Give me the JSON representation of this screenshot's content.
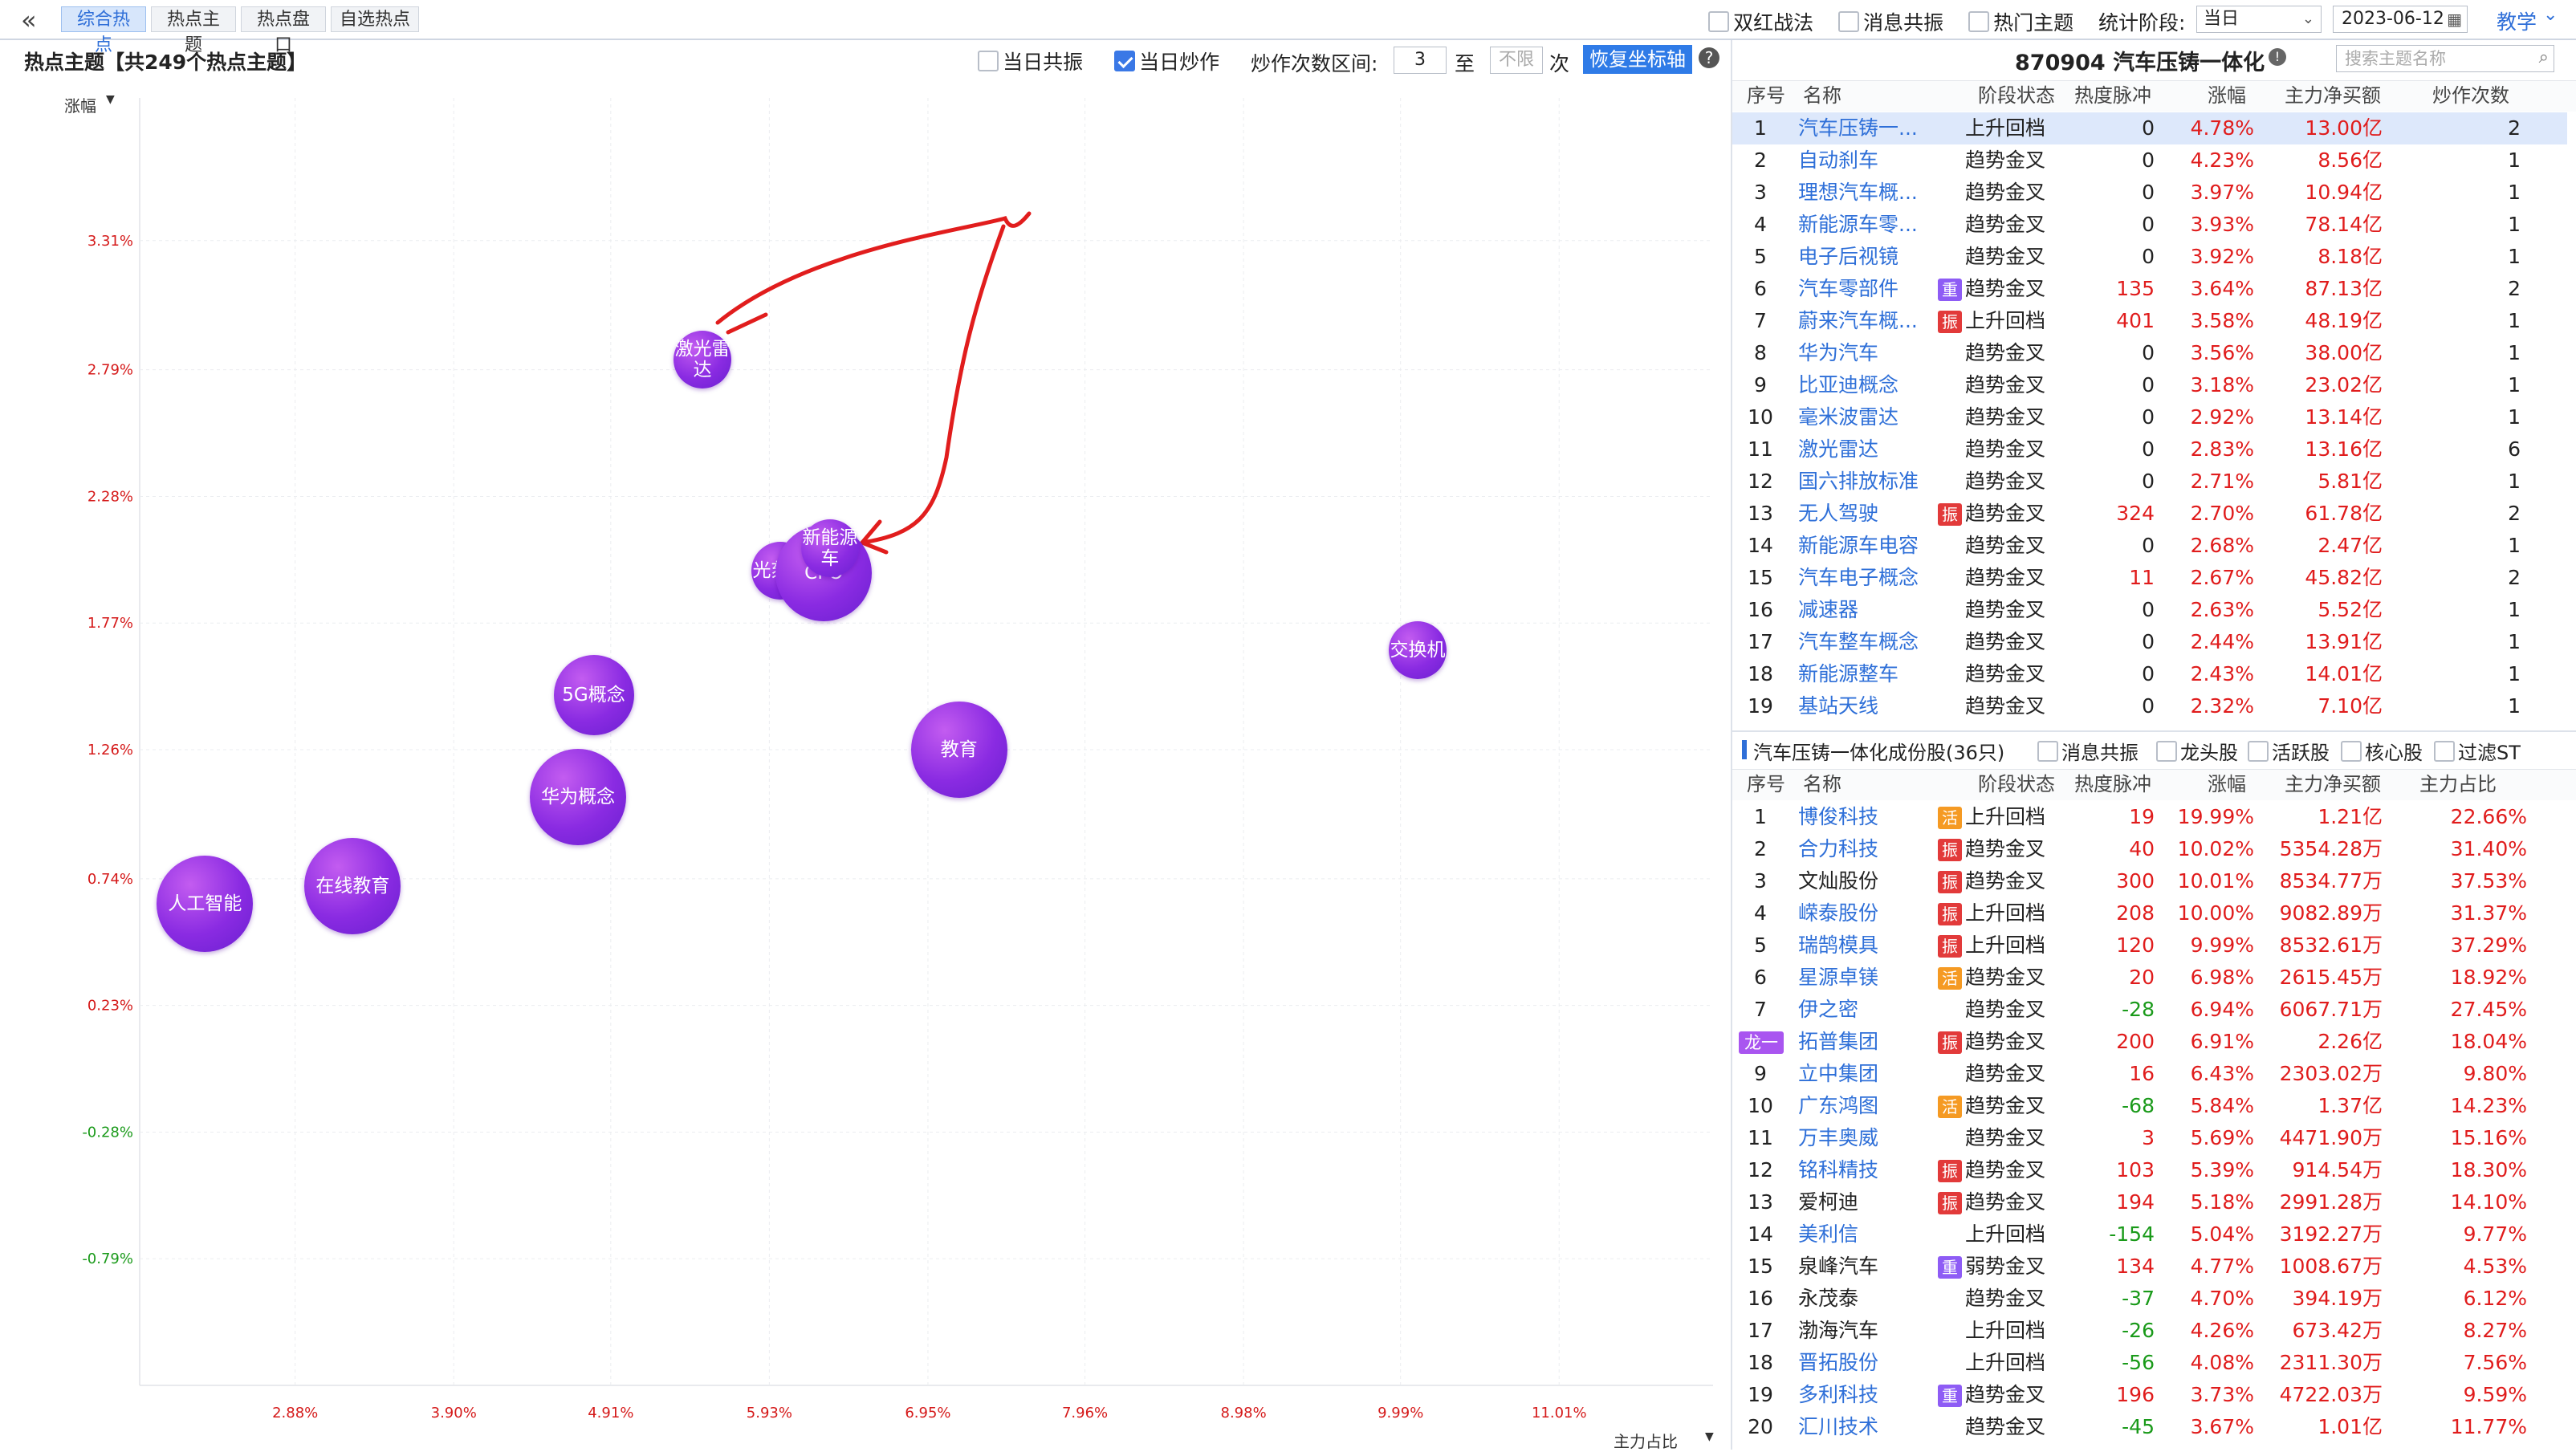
{
  "topbar": {
    "nav_icon": "double-chevron-left-icon",
    "tabs": [
      "综合热点",
      "热点主题",
      "热点盘口",
      "自选热点"
    ],
    "active_tab": 0,
    "options": [
      {
        "label": "双红战法",
        "checked": false
      },
      {
        "label": "消息共振",
        "checked": false
      },
      {
        "label": "热门主题",
        "checked": false
      }
    ],
    "period_label": "统计阶段:",
    "period_value": "当日",
    "date_value": "2023-06-12",
    "teach_label": "教学"
  },
  "chart_panel": {
    "title": "热点主题【共249个热点主题】",
    "same_day_resonance": {
      "label": "当日共振",
      "checked": false
    },
    "same_day_hype": {
      "label": "当日炒作",
      "checked": true
    },
    "range_label": "炒作次数区间:",
    "range_from": "3",
    "range_to_sep": "至",
    "range_to_placeholder": "不限",
    "range_unit": "次",
    "reset_button": "恢复坐标轴",
    "help_icon": "question-circle-icon",
    "y_axis_label": "涨幅",
    "x_axis_label": "主力占比"
  },
  "chart_data": {
    "type": "scatter",
    "xlabel": "主力占比",
    "ylabel": "涨幅",
    "y_ticks": [
      "3.31%",
      "2.79%",
      "2.28%",
      "1.77%",
      "1.26%",
      "0.74%",
      "0.23%",
      "-0.28%",
      "-0.79%"
    ],
    "y_tick_values": [
      3.31,
      2.79,
      2.28,
      1.77,
      1.26,
      0.74,
      0.23,
      -0.28,
      -0.79
    ],
    "x_ticks": [
      "2.88%",
      "3.90%",
      "4.91%",
      "5.93%",
      "6.95%",
      "7.96%",
      "8.98%",
      "9.99%",
      "11.01%"
    ],
    "x_tick_values": [
      2.88,
      3.9,
      4.91,
      5.93,
      6.95,
      7.96,
      8.98,
      9.99,
      11.01
    ],
    "xlim": [
      1.88,
      12.0
    ],
    "ylim": [
      -1.3,
      3.82
    ],
    "points": [
      {
        "name": "激光雷达",
        "x": 5.5,
        "y": 2.83,
        "size": 36,
        "lines": [
          "激光雷",
          "达"
        ]
      },
      {
        "name": "光刻机",
        "x": 6.0,
        "y": 1.98,
        "size": 36,
        "lines": [
          "光刻机"
        ]
      },
      {
        "name": "CPO",
        "x": 6.28,
        "y": 1.97,
        "size": 60,
        "lines": [
          "CPO"
        ]
      },
      {
        "name": "新能源车",
        "x": 6.32,
        "y": 2.07,
        "size": 36,
        "lines": [
          "新能源",
          "车"
        ]
      },
      {
        "name": "交换机",
        "x": 10.1,
        "y": 1.66,
        "size": 36,
        "lines": [
          "交换机"
        ]
      },
      {
        "name": "5G概念",
        "x": 4.8,
        "y": 1.48,
        "size": 50,
        "lines": [
          "5G概念"
        ]
      },
      {
        "name": "教育",
        "x": 7.15,
        "y": 1.26,
        "size": 60,
        "lines": [
          "教育"
        ]
      },
      {
        "name": "华为概念",
        "x": 4.7,
        "y": 1.07,
        "size": 60,
        "lines": [
          "华为概念"
        ]
      },
      {
        "name": "在线教育",
        "x": 3.25,
        "y": 0.71,
        "size": 60,
        "lines": [
          "在线教育"
        ]
      },
      {
        "name": "人工智能",
        "x": 2.3,
        "y": 0.64,
        "size": 60,
        "lines": [
          "人工智能"
        ]
      }
    ],
    "grid": true
  },
  "theme_panel": {
    "title": "870904 汽车压铸一体化",
    "info_icon": "info-circle-icon",
    "search_placeholder": "搜索主题名称",
    "search_icon": "search-icon",
    "headers": [
      "序号",
      "名称",
      "阶段状态",
      "热度脉冲",
      "涨幅",
      "主力净买额",
      "炒作次数"
    ],
    "rows": [
      {
        "no": "1",
        "name": "汽车压铸一...",
        "tag": "",
        "status": "上升回档",
        "pulse": "0",
        "chg": "4.78%",
        "net": "13.00亿",
        "count": "2"
      },
      {
        "no": "2",
        "name": "自动刹车",
        "tag": "",
        "status": "趋势金叉",
        "pulse": "0",
        "chg": "4.23%",
        "net": "8.56亿",
        "count": "1"
      },
      {
        "no": "3",
        "name": "理想汽车概...",
        "tag": "",
        "status": "趋势金叉",
        "pulse": "0",
        "chg": "3.97%",
        "net": "10.94亿",
        "count": "1"
      },
      {
        "no": "4",
        "name": "新能源车零...",
        "tag": "",
        "status": "趋势金叉",
        "pulse": "0",
        "chg": "3.93%",
        "net": "78.14亿",
        "count": "1"
      },
      {
        "no": "5",
        "name": "电子后视镜",
        "tag": "",
        "status": "趋势金叉",
        "pulse": "0",
        "chg": "3.92%",
        "net": "8.18亿",
        "count": "1"
      },
      {
        "no": "6",
        "name": "汽车零部件",
        "tag": "重",
        "status": "趋势金叉",
        "pulse": "135",
        "chg": "3.64%",
        "net": "87.13亿",
        "count": "2"
      },
      {
        "no": "7",
        "name": "蔚来汽车概...",
        "tag": "振",
        "status": "上升回档",
        "pulse": "401",
        "chg": "3.58%",
        "net": "48.19亿",
        "count": "1"
      },
      {
        "no": "8",
        "name": "华为汽车",
        "tag": "",
        "status": "趋势金叉",
        "pulse": "0",
        "chg": "3.56%",
        "net": "38.00亿",
        "count": "1"
      },
      {
        "no": "9",
        "name": "比亚迪概念",
        "tag": "",
        "status": "趋势金叉",
        "pulse": "0",
        "chg": "3.18%",
        "net": "23.02亿",
        "count": "1"
      },
      {
        "no": "10",
        "name": "毫米波雷达",
        "tag": "",
        "status": "趋势金叉",
        "pulse": "0",
        "chg": "2.92%",
        "net": "13.14亿",
        "count": "1"
      },
      {
        "no": "11",
        "name": "激光雷达",
        "tag": "",
        "status": "趋势金叉",
        "pulse": "0",
        "chg": "2.83%",
        "net": "13.16亿",
        "count": "6"
      },
      {
        "no": "12",
        "name": "国六排放标准",
        "tag": "",
        "status": "趋势金叉",
        "pulse": "0",
        "chg": "2.71%",
        "net": "5.81亿",
        "count": "1"
      },
      {
        "no": "13",
        "name": "无人驾驶",
        "tag": "振",
        "status": "趋势金叉",
        "pulse": "324",
        "chg": "2.70%",
        "net": "61.78亿",
        "count": "2"
      },
      {
        "no": "14",
        "name": "新能源车电容",
        "tag": "",
        "status": "趋势金叉",
        "pulse": "0",
        "chg": "2.68%",
        "net": "2.47亿",
        "count": "1"
      },
      {
        "no": "15",
        "name": "汽车电子概念",
        "tag": "",
        "status": "趋势金叉",
        "pulse": "11",
        "chg": "2.67%",
        "net": "45.82亿",
        "count": "2"
      },
      {
        "no": "16",
        "name": "减速器",
        "tag": "",
        "status": "趋势金叉",
        "pulse": "0",
        "chg": "2.63%",
        "net": "5.52亿",
        "count": "1"
      },
      {
        "no": "17",
        "name": "汽车整车概念",
        "tag": "",
        "status": "趋势金叉",
        "pulse": "0",
        "chg": "2.44%",
        "net": "13.91亿",
        "count": "1"
      },
      {
        "no": "18",
        "name": "新能源整车",
        "tag": "",
        "status": "趋势金叉",
        "pulse": "0",
        "chg": "2.43%",
        "net": "14.01亿",
        "count": "1"
      },
      {
        "no": "19",
        "name": "基站天线",
        "tag": "",
        "status": "趋势金叉",
        "pulse": "0",
        "chg": "2.32%",
        "net": "7.10亿",
        "count": "1"
      }
    ]
  },
  "stock_panel": {
    "title": "汽车压铸一体化成份股(36只)",
    "filters": [
      {
        "label": "消息共振",
        "checked": false
      },
      {
        "label": "龙头股",
        "checked": false
      },
      {
        "label": "活跃股",
        "checked": false
      },
      {
        "label": "核心股",
        "checked": false
      },
      {
        "label": "过滤ST",
        "checked": false
      }
    ],
    "headers": [
      "序号",
      "名称",
      "阶段状态",
      "热度脉冲",
      "涨幅",
      "主力净买额",
      "主力占比"
    ],
    "rows": [
      {
        "no": "1",
        "name": "博俊科技",
        "blue": true,
        "tag": "活",
        "status": "上升回档",
        "pulse": "19",
        "chg": "19.99%",
        "net": "1.21亿",
        "ratio": "22.66%"
      },
      {
        "no": "2",
        "name": "合力科技",
        "blue": true,
        "tag": "振",
        "status": "趋势金叉",
        "pulse": "40",
        "chg": "10.02%",
        "net": "5354.28万",
        "ratio": "31.40%"
      },
      {
        "no": "3",
        "name": "文灿股份",
        "blue": false,
        "tag": "振",
        "status": "趋势金叉",
        "pulse": "300",
        "chg": "10.01%",
        "net": "8534.77万",
        "ratio": "37.53%"
      },
      {
        "no": "4",
        "name": "嵘泰股份",
        "blue": true,
        "tag": "振",
        "status": "上升回档",
        "pulse": "208",
        "chg": "10.00%",
        "net": "9082.89万",
        "ratio": "31.37%"
      },
      {
        "no": "5",
        "name": "瑞鹄模具",
        "blue": true,
        "tag": "振",
        "status": "上升回档",
        "pulse": "120",
        "chg": "9.99%",
        "net": "8532.61万",
        "ratio": "37.29%"
      },
      {
        "no": "6",
        "name": "星源卓镁",
        "blue": true,
        "tag": "活",
        "status": "趋势金叉",
        "pulse": "20",
        "chg": "6.98%",
        "net": "2615.45万",
        "ratio": "18.92%"
      },
      {
        "no": "7",
        "name": "伊之密",
        "blue": true,
        "tag": "",
        "status": "趋势金叉",
        "pulse": "-28",
        "chg": "6.94%",
        "net": "6067.71万",
        "ratio": "27.45%"
      },
      {
        "no": "龙一",
        "name": "拓普集团",
        "blue": true,
        "tag": "振",
        "status": "趋势金叉",
        "pulse": "200",
        "chg": "6.91%",
        "net": "2.26亿",
        "ratio": "18.04%"
      },
      {
        "no": "9",
        "name": "立中集团",
        "blue": true,
        "tag": "",
        "status": "趋势金叉",
        "pulse": "16",
        "chg": "6.43%",
        "net": "2303.02万",
        "ratio": "9.80%"
      },
      {
        "no": "10",
        "name": "广东鸿图",
        "blue": true,
        "tag": "活",
        "status": "趋势金叉",
        "pulse": "-68",
        "chg": "5.84%",
        "net": "1.37亿",
        "ratio": "14.23%"
      },
      {
        "no": "11",
        "name": "万丰奥威",
        "blue": true,
        "tag": "",
        "status": "趋势金叉",
        "pulse": "3",
        "chg": "5.69%",
        "net": "4471.90万",
        "ratio": "15.16%"
      },
      {
        "no": "12",
        "name": "铭科精技",
        "blue": true,
        "tag": "振",
        "status": "趋势金叉",
        "pulse": "103",
        "chg": "5.39%",
        "net": "914.54万",
        "ratio": "18.30%"
      },
      {
        "no": "13",
        "name": "爱柯迪",
        "blue": false,
        "tag": "振",
        "status": "趋势金叉",
        "pulse": "194",
        "chg": "5.18%",
        "net": "2991.28万",
        "ratio": "14.10%"
      },
      {
        "no": "14",
        "name": "美利信",
        "blue": true,
        "tag": "",
        "status": "上升回档",
        "pulse": "-154",
        "chg": "5.04%",
        "net": "3192.27万",
        "ratio": "9.77%"
      },
      {
        "no": "15",
        "name": "泉峰汽车",
        "blue": false,
        "tag": "重",
        "status": "弱势金叉",
        "pulse": "134",
        "chg": "4.77%",
        "net": "1008.67万",
        "ratio": "4.53%"
      },
      {
        "no": "16",
        "name": "永茂泰",
        "blue": false,
        "tag": "",
        "status": "趋势金叉",
        "pulse": "-37",
        "chg": "4.70%",
        "net": "394.19万",
        "ratio": "6.12%"
      },
      {
        "no": "17",
        "name": "渤海汽车",
        "blue": false,
        "tag": "",
        "status": "上升回档",
        "pulse": "-26",
        "chg": "4.26%",
        "net": "673.42万",
        "ratio": "8.27%"
      },
      {
        "no": "18",
        "name": "晋拓股份",
        "blue": true,
        "tag": "",
        "status": "上升回档",
        "pulse": "-56",
        "chg": "4.08%",
        "net": "2311.30万",
        "ratio": "7.56%"
      },
      {
        "no": "19",
        "name": "多利科技",
        "blue": true,
        "tag": "重",
        "status": "趋势金叉",
        "pulse": "196",
        "chg": "3.73%",
        "net": "4722.03万",
        "ratio": "9.59%"
      },
      {
        "no": "20",
        "name": "汇川技术",
        "blue": true,
        "tag": "",
        "status": "趋势金叉",
        "pulse": "-45",
        "chg": "3.67%",
        "net": "1.01亿",
        "ratio": "11.77%"
      }
    ]
  }
}
